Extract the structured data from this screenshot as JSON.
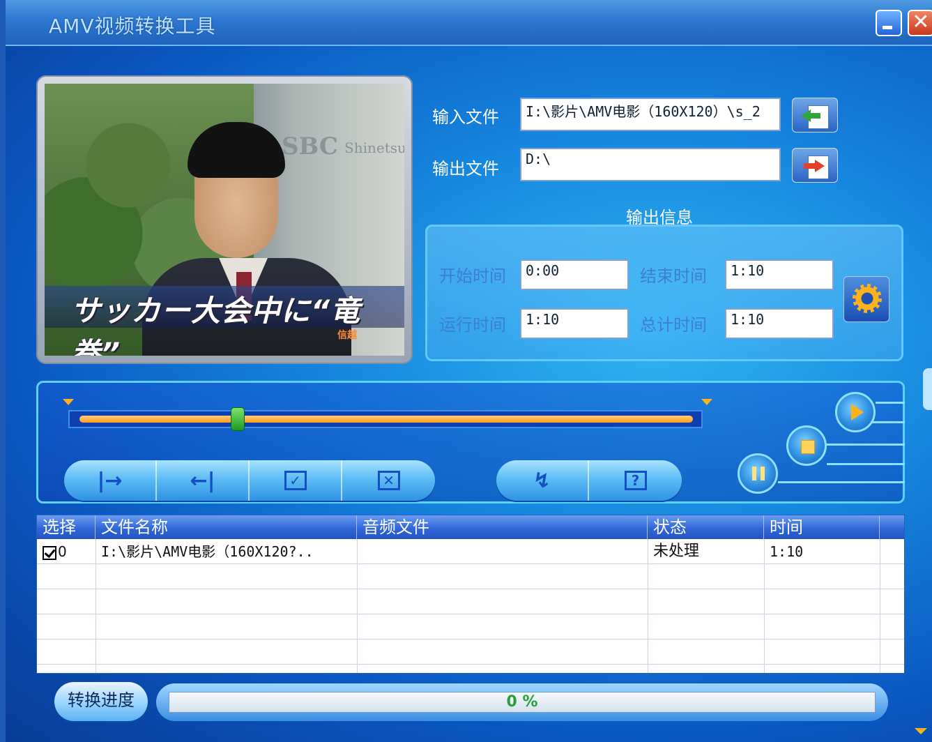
{
  "window": {
    "title": "AMV视频转换工具",
    "minimize_icon": "minimize-icon",
    "close_glyph": "✕"
  },
  "preview": {
    "caption": "サッカー大会中に“竜巻”",
    "sign_text": "SBC",
    "sign_text2": "Shinetsu",
    "logo_text": "信越"
  },
  "files": {
    "input_label": "输入文件",
    "input_value": "I:\\影片\\AMV电影（160X120）\\s_2",
    "output_label": "输出文件",
    "output_value": "D:\\"
  },
  "output_info": {
    "title": "输出信息",
    "start_label": "开始时间",
    "start_value": "0:00",
    "end_label": "结束时间",
    "end_value": "1:10",
    "run_label": "运行时间",
    "run_value": "1:10",
    "total_label": "总计时间",
    "total_value": "1:10"
  },
  "timeline": {
    "position_fraction": 0.26
  },
  "toolbar": {
    "set_start_glyph": "|→",
    "set_end_glyph": "←|",
    "check_glyph": "✓",
    "remove_glyph": "✕",
    "convert_glyph": "↯",
    "help_glyph": "?"
  },
  "table": {
    "headers": [
      "选择",
      "文件名称",
      "音频文件",
      "状态",
      "时间"
    ],
    "rows": [
      {
        "index": "0",
        "filename": "I:\\影片\\AMV电影（160X120?..",
        "audio": "",
        "status": "未处理",
        "time": "1:10"
      }
    ]
  },
  "progress": {
    "label": "转换进度",
    "value_text": "0 %",
    "value_fraction": 0
  },
  "colors": {
    "accent_orange": "#ffb31a",
    "progress_green": "#27a03b"
  }
}
